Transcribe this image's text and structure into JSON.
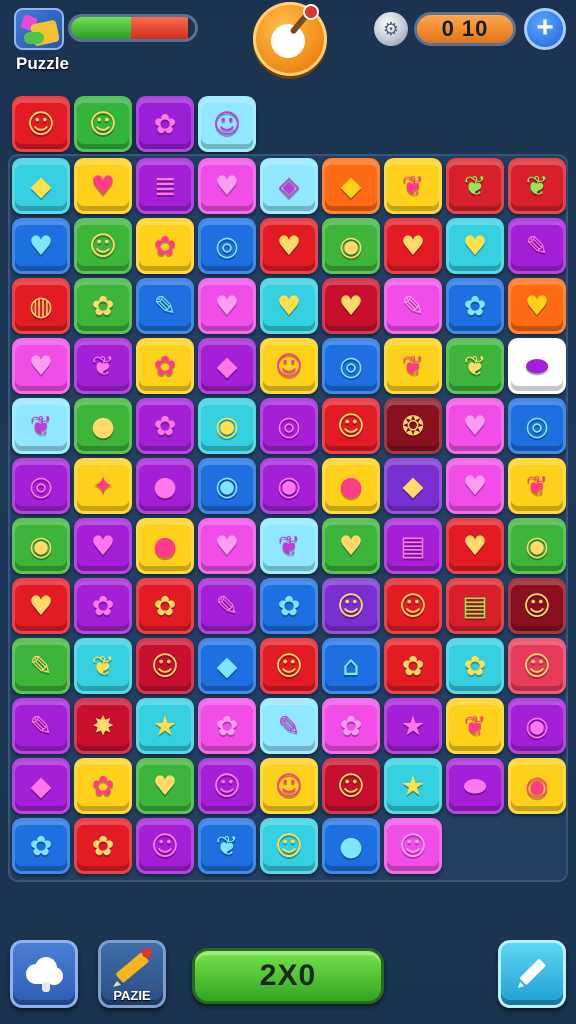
{
  "header": {
    "app_title": "Puzzle",
    "score_value": "0 10",
    "plus_label": "+"
  },
  "health_bar": {
    "green_fraction": 0.48,
    "red_fraction": 0.46
  },
  "preview_row": [
    {
      "color": "#e31b23",
      "glyph": "☺",
      "icon": "face-icon"
    },
    {
      "color": "#33b43a",
      "glyph": "☺",
      "icon": "face-icon"
    },
    {
      "color": "#9b1fd6",
      "glyph": "✿",
      "icon": "flower-icon"
    },
    {
      "color": "#8fe8ff",
      "glyph": "☺",
      "icon": "face-icon"
    }
  ],
  "board": [
    [
      {
        "color": "#35d0e0",
        "glyph": "◆",
        "icon": "gem-icon"
      },
      {
        "color": "#ffd11a",
        "glyph": "♥",
        "icon": "heart-icon"
      },
      {
        "color": "#a41fd6",
        "glyph": "≣",
        "icon": "stack-icon"
      },
      {
        "color": "#f04ee6",
        "glyph": "♥",
        "icon": "heart-icon"
      },
      {
        "color": "#8fe8ff",
        "glyph": "◈",
        "icon": "ribbon-icon"
      },
      {
        "color": "#ff6a12",
        "glyph": "◆",
        "icon": "gem-icon"
      },
      {
        "color": "#ffd11a",
        "glyph": "❦",
        "icon": "leaf-icon"
      },
      {
        "color": "#d9202a",
        "glyph": "❦",
        "icon": "leaf-icon"
      },
      {
        "color": "#d9202a",
        "glyph": "❦",
        "icon": "leaf-icon"
      }
    ],
    [
      {
        "color": "#1e6fe0",
        "glyph": "♥",
        "icon": "heart-icon"
      },
      {
        "color": "#3db43a",
        "glyph": "☺",
        "icon": "face-icon"
      },
      {
        "color": "#ffd11a",
        "glyph": "✿",
        "icon": "flower-icon"
      },
      {
        "color": "#1e6fe0",
        "glyph": "◎",
        "icon": "ring-icon"
      },
      {
        "color": "#e31b23",
        "glyph": "♥",
        "icon": "heart-icon"
      },
      {
        "color": "#3db43a",
        "glyph": "◉",
        "icon": "ball-icon"
      },
      {
        "color": "#e31b23",
        "glyph": "♥",
        "icon": "heart-icon"
      },
      {
        "color": "#35d0e0",
        "glyph": "♥",
        "icon": "heart-icon"
      },
      {
        "color": "#a41fd6",
        "glyph": "✎",
        "icon": "candy-stick-icon"
      }
    ],
    [
      {
        "color": "#e31b23",
        "glyph": "◍",
        "icon": "swirl-icon"
      },
      {
        "color": "#3db43a",
        "glyph": "✿",
        "icon": "flower-icon"
      },
      {
        "color": "#1e6fe0",
        "glyph": "✎",
        "icon": "candy-stick-icon"
      },
      {
        "color": "#f04ee6",
        "glyph": "♥",
        "icon": "heart-icon"
      },
      {
        "color": "#35d0e0",
        "glyph": "♥",
        "icon": "heart-icon"
      },
      {
        "color": "#c8102e",
        "glyph": "♥",
        "icon": "heart-icon"
      },
      {
        "color": "#f04ee6",
        "glyph": "✎",
        "icon": "candy-stick-icon"
      },
      {
        "color": "#1e6fe0",
        "glyph": "✿",
        "icon": "flower-icon"
      },
      {
        "color": "#ff6a12",
        "glyph": "♥",
        "icon": "heart-icon"
      }
    ],
    [
      {
        "color": "#f04ee6",
        "glyph": "♥",
        "icon": "heart-icon"
      },
      {
        "color": "#a41fd6",
        "glyph": "❦",
        "icon": "leaf-icon"
      },
      {
        "color": "#ffd11a",
        "glyph": "✿",
        "icon": "flower-icon"
      },
      {
        "color": "#a41fd6",
        "glyph": "◆",
        "icon": "gem-icon"
      },
      {
        "color": "#ffd11a",
        "glyph": "☺",
        "icon": "face-icon"
      },
      {
        "color": "#1e6fe0",
        "glyph": "◎",
        "icon": "ring-icon"
      },
      {
        "color": "#ffd11a",
        "glyph": "❦",
        "icon": "leaf-icon"
      },
      {
        "color": "#3db43a",
        "glyph": "❦",
        "icon": "leaf-icon"
      },
      {
        "color": "#ffffff",
        "glyph": "⬬",
        "icon": "pill-icon"
      }
    ],
    [
      {
        "color": "#8fe8ff",
        "glyph": "❦",
        "icon": "leaf-icon"
      },
      {
        "color": "#3db43a",
        "glyph": "●",
        "icon": "apple-icon"
      },
      {
        "color": "#a41fd6",
        "glyph": "✿",
        "icon": "flower-icon"
      },
      {
        "color": "#35d0e0",
        "glyph": "◉",
        "icon": "ball-icon"
      },
      {
        "color": "#a41fd6",
        "glyph": "◎",
        "icon": "ring-icon"
      },
      {
        "color": "#e31b23",
        "glyph": "☺",
        "icon": "face-icon"
      },
      {
        "color": "#8a1020",
        "glyph": "❂",
        "icon": "shell-icon"
      },
      {
        "color": "#f04ee6",
        "glyph": "♥",
        "icon": "heart-icon"
      },
      {
        "color": "#1e6fe0",
        "glyph": "◎",
        "icon": "ring-icon"
      }
    ],
    [
      {
        "color": "#a41fd6",
        "glyph": "◎",
        "icon": "ring-icon"
      },
      {
        "color": "#ffd11a",
        "glyph": "✦",
        "icon": "star-icon"
      },
      {
        "color": "#a41fd6",
        "glyph": "●",
        "icon": "ball-icon"
      },
      {
        "color": "#1e6fe0",
        "glyph": "◉",
        "icon": "ball-icon"
      },
      {
        "color": "#a41fd6",
        "glyph": "◉",
        "icon": "ball-icon"
      },
      {
        "color": "#ffd11a",
        "glyph": "●",
        "icon": "apple-icon"
      },
      {
        "color": "#7a2fd0",
        "glyph": "◆",
        "icon": "gem-icon"
      },
      {
        "color": "#f04ee6",
        "glyph": "♥",
        "icon": "heart-icon"
      },
      {
        "color": "#ffd11a",
        "glyph": "❦",
        "icon": "leaf-icon"
      }
    ],
    [
      {
        "color": "#3db43a",
        "glyph": "◉",
        "icon": "ball-icon"
      },
      {
        "color": "#a41fd6",
        "glyph": "♥",
        "icon": "heart-icon"
      },
      {
        "color": "#ffd11a",
        "glyph": "●",
        "icon": "apple-icon"
      },
      {
        "color": "#f04ee6",
        "glyph": "♥",
        "icon": "heart-icon"
      },
      {
        "color": "#8fe8ff",
        "glyph": "❦",
        "icon": "leaf-icon"
      },
      {
        "color": "#3db43a",
        "glyph": "♥",
        "icon": "heart-icon"
      },
      {
        "color": "#a41fd6",
        "glyph": "▤",
        "icon": "flag-icon"
      },
      {
        "color": "#e31b23",
        "glyph": "♥",
        "icon": "heart-icon"
      },
      {
        "color": "#3db43a",
        "glyph": "◉",
        "icon": "ball-icon"
      }
    ],
    [
      {
        "color": "#e31b23",
        "glyph": "♥",
        "icon": "heart-icon"
      },
      {
        "color": "#a41fd6",
        "glyph": "✿",
        "icon": "flower-icon"
      },
      {
        "color": "#e31b23",
        "glyph": "✿",
        "icon": "flower-icon"
      },
      {
        "color": "#a41fd6",
        "glyph": "✎",
        "icon": "candy-stick-icon"
      },
      {
        "color": "#1e6fe0",
        "glyph": "✿",
        "icon": "flower-icon"
      },
      {
        "color": "#7a2fd0",
        "glyph": "☺",
        "icon": "face-icon"
      },
      {
        "color": "#e31b23",
        "glyph": "☺",
        "icon": "face-icon"
      },
      {
        "color": "#d9202a",
        "glyph": "▤",
        "icon": "box-icon"
      },
      {
        "color": "#8a1020",
        "glyph": "☺",
        "icon": "face-icon"
      }
    ],
    [
      {
        "color": "#3db43a",
        "glyph": "✎",
        "icon": "candy-stick-icon"
      },
      {
        "color": "#35d0e0",
        "glyph": "❦",
        "icon": "leaf-icon"
      },
      {
        "color": "#c8102e",
        "glyph": "☺",
        "icon": "face-icon"
      },
      {
        "color": "#1e6fe0",
        "glyph": "◆",
        "icon": "gem-icon"
      },
      {
        "color": "#e31b23",
        "glyph": "☺",
        "icon": "face-icon"
      },
      {
        "color": "#1e6fe0",
        "glyph": "⌂",
        "icon": "house-icon"
      },
      {
        "color": "#e31b23",
        "glyph": "✿",
        "icon": "flower-icon"
      },
      {
        "color": "#35d0e0",
        "glyph": "✿",
        "icon": "flower-icon"
      },
      {
        "color": "#e83a5a",
        "glyph": "☺",
        "icon": "face-icon"
      }
    ],
    [
      {
        "color": "#a41fd6",
        "glyph": "✎",
        "icon": "candy-stick-icon"
      },
      {
        "color": "#c8102e",
        "glyph": "✸",
        "icon": "star-icon"
      },
      {
        "color": "#35d0e0",
        "glyph": "★",
        "icon": "star-icon"
      },
      {
        "color": "#f04ee6",
        "glyph": "✿",
        "icon": "flower-icon"
      },
      {
        "color": "#8fe8ff",
        "glyph": "✎",
        "icon": "candy-stick-icon"
      },
      {
        "color": "#f04ee6",
        "glyph": "✿",
        "icon": "flower-icon"
      },
      {
        "color": "#a41fd6",
        "glyph": "★",
        "icon": "star-icon"
      },
      {
        "color": "#ffd11a",
        "glyph": "❦",
        "icon": "leaf-icon"
      },
      {
        "color": "#a41fd6",
        "glyph": "◉",
        "icon": "ball-icon"
      }
    ],
    [
      {
        "color": "#a41fd6",
        "glyph": "◆",
        "icon": "gem-icon"
      },
      {
        "color": "#ffd11a",
        "glyph": "✿",
        "icon": "flower-icon"
      },
      {
        "color": "#3db43a",
        "glyph": "♥",
        "icon": "heart-icon"
      },
      {
        "color": "#a41fd6",
        "glyph": "☺",
        "icon": "face-icon"
      },
      {
        "color": "#ffd11a",
        "glyph": "☺",
        "icon": "face-icon"
      },
      {
        "color": "#c8102e",
        "glyph": "☺",
        "icon": "face-icon"
      },
      {
        "color": "#35d0e0",
        "glyph": "★",
        "icon": "star-icon"
      },
      {
        "color": "#a41fd6",
        "glyph": "⬬",
        "icon": "pill-icon"
      },
      {
        "color": "#ffd11a",
        "glyph": "◉",
        "icon": "ball-icon"
      }
    ],
    [
      {
        "color": "#1e6fe0",
        "glyph": "✿",
        "icon": "flower-icon"
      },
      {
        "color": "#e31b23",
        "glyph": "✿",
        "icon": "flower-icon"
      },
      {
        "color": "#a41fd6",
        "glyph": "☺",
        "icon": "face-icon"
      },
      {
        "color": "#1e6fe0",
        "glyph": "❦",
        "icon": "leaf-icon"
      },
      {
        "color": "#35d0e0",
        "glyph": "☺",
        "icon": "face-icon"
      },
      {
        "color": "#1e6fe0",
        "glyph": "●",
        "icon": "ball-icon"
      },
      {
        "color": "#f04ee6",
        "glyph": "☺",
        "icon": "face-icon"
      }
    ]
  ],
  "glyph_colors": {
    "#e31b23": "#ffd96a",
    "#d9202a": "#8dea5a",
    "#c8102e": "#ffd96a",
    "#8a1020": "#ffd96a",
    "#33b43a": "#ffd96a",
    "#3db43a": "#ffd96a",
    "#9b1fd6": "#ff77ea",
    "#a41fd6": "#ff77ea",
    "#7a2fd0": "#ffd96a",
    "#8fe8ff": "#c43ad6",
    "#35d0e0": "#ffe04a",
    "#ffd11a": "#ff3b8a",
    "#f04ee6": "#ff9df2",
    "#ff6a12": "#ffd11a",
    "#1e6fe0": "#7fe6ff",
    "#ffffff": "#a41fd6",
    "#e83a5a": "#ffd96a"
  },
  "footer": {
    "pencil_label": "PAZIE",
    "score_text": "2X0"
  }
}
